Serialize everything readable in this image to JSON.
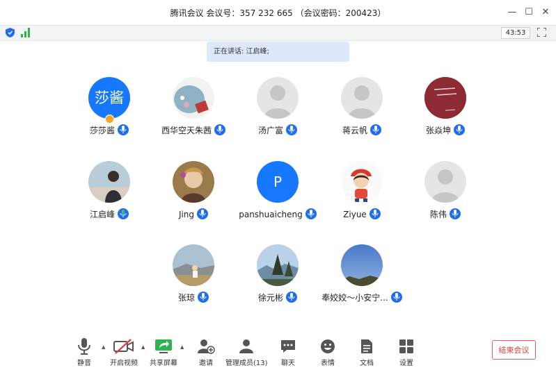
{
  "window": {
    "title": "腾讯会议 会议号：357 232 665 （会议密码：200423）",
    "minimize_glyph": "—",
    "maximize_glyph": "☐",
    "close_glyph": "✕"
  },
  "status": {
    "timer": "43:53",
    "signal_icon": "signal-bars-icon",
    "shield_icon": "shield-icon"
  },
  "speaking": {
    "text": "正在讲话: 江启峰;"
  },
  "participants": [
    {
      "name": "莎莎酱",
      "avatar_text": "莎酱",
      "avatar_type": "text",
      "color": "#1677ff",
      "mic": "on",
      "host": true
    },
    {
      "name": "西华空天朱茜",
      "avatar_type": "photo",
      "mic": "on"
    },
    {
      "name": "汤广富",
      "avatar_type": "default",
      "mic": "on"
    },
    {
      "name": "蒋云帆",
      "avatar_type": "default",
      "mic": "on"
    },
    {
      "name": "张焱坤",
      "avatar_type": "photo",
      "mic": "on"
    },
    {
      "name": "江启峰",
      "avatar_type": "photo",
      "mic": "speaking"
    },
    {
      "name": "Jing",
      "avatar_type": "photo",
      "mic": "on"
    },
    {
      "name": "panshuaicheng",
      "avatar_text": "P",
      "avatar_type": "text",
      "color": "#1677ff",
      "mic": "on"
    },
    {
      "name": "Ziyue",
      "avatar_type": "photo",
      "mic": "on"
    },
    {
      "name": "陈伟",
      "avatar_type": "default",
      "mic": "on"
    },
    {
      "name": "张琼",
      "avatar_type": "photo",
      "mic": "on"
    },
    {
      "name": "徐元彬",
      "avatar_type": "photo",
      "mic": "on"
    },
    {
      "name": "奉姣姣～小安宁...",
      "avatar_type": "photo",
      "mic": "on"
    }
  ],
  "toolbar": {
    "mute": "静音",
    "video": "开启视频",
    "share": "共享屏幕",
    "invite": "邀请",
    "members": "管理成员(13)",
    "chat": "聊天",
    "emoji": "表情",
    "docs": "文档",
    "settings": "设置",
    "end": "结束会议"
  },
  "colors": {
    "accent": "#1f6df0",
    "danger": "#e03a3a",
    "speaking_bg": "#dde9fb"
  }
}
